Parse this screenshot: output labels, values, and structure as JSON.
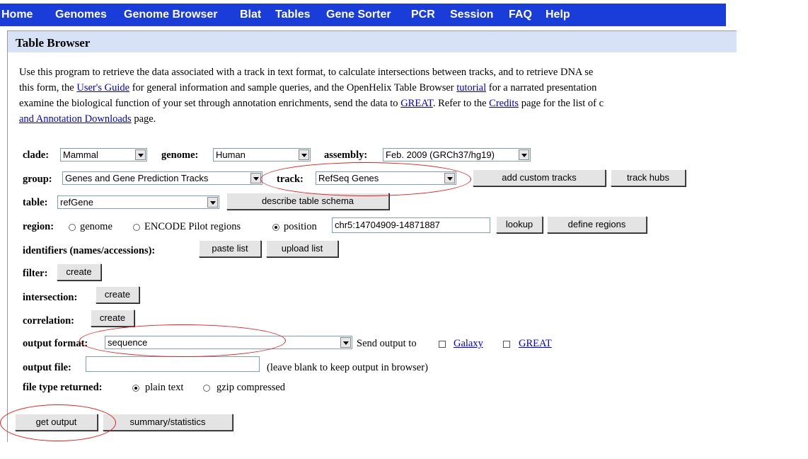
{
  "nav": [
    "Home",
    "Genomes",
    "Genome Browser",
    "Blat",
    "Tables",
    "Gene Sorter",
    "PCR",
    "Session",
    "FAQ",
    "Help"
  ],
  "title": "Table Browser",
  "intro": {
    "l1": "Use this program to retrieve the data associated with a track in text format, to calculate intersections between tracks, and to retrieve DNA se",
    "l2a": "this form, the ",
    "l2_link1": "User's Guide",
    "l2b": " for general information and sample queries, and the OpenHelix Table Browser ",
    "l2_link2": "tutorial",
    "l2c": " for a narrated presentation",
    "l3a": "examine the biological function of your set through annotation enrichments, send the data to ",
    "l3_link1": "GREAT",
    "l3b": ". Refer to the ",
    "l3_link2": "Credits",
    "l3c": " page for the list of c",
    "l4_link": "and Annotation Downloads",
    "l4b": " page."
  },
  "form": {
    "clade_label": "clade:",
    "clade_value": "Mammal",
    "genome_label": "genome:",
    "genome_value": "Human",
    "assembly_label": "assembly:",
    "assembly_value": "Feb. 2009 (GRCh37/hg19)",
    "group_label": "group:",
    "group_value": "Genes and Gene Prediction Tracks",
    "track_label": "track:",
    "track_value": "RefSeq Genes",
    "add_custom_tracks": "add custom tracks",
    "track_hubs": "track hubs",
    "table_label": "table:",
    "table_value": "refGene",
    "describe_schema": "describe table schema",
    "region_label": "region:",
    "region_genome": "genome",
    "region_encode": "ENCODE Pilot regions",
    "region_position": "position",
    "position_value": "chr5:14704909-14871887",
    "lookup": "lookup",
    "define_regions": "define regions",
    "identifiers_label": "identifiers (names/accessions):",
    "paste_list": "paste list",
    "upload_list": "upload list",
    "filter_label": "filter:",
    "filter_create": "create",
    "intersection_label": "intersection:",
    "intersection_create": "create",
    "correlation_label": "correlation:",
    "correlation_create": "create",
    "output_format_label": "output format:",
    "output_format_value": "sequence",
    "send_output_to": "Send output to",
    "galaxy": "Galaxy",
    "great": "GREAT",
    "output_file_label": "output file:",
    "output_file_value": "",
    "output_file_hint": "(leave blank to keep output in browser)",
    "file_type_label": "file type returned:",
    "plain_text": "plain text",
    "gzip": "gzip compressed",
    "get_output": "get output",
    "summary_statistics": "summary/statistics"
  }
}
